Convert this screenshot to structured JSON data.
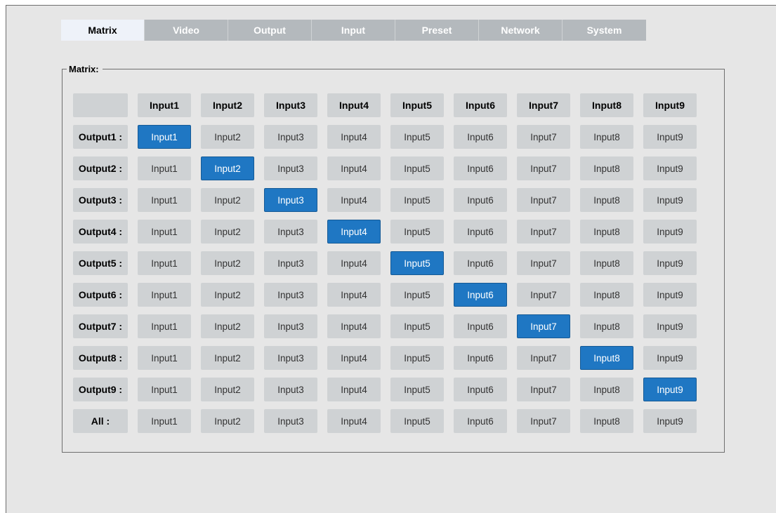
{
  "tabs": [
    {
      "label": "Matrix",
      "active": true
    },
    {
      "label": "Video",
      "active": false
    },
    {
      "label": "Output",
      "active": false
    },
    {
      "label": "Input",
      "active": false
    },
    {
      "label": "Preset",
      "active": false
    },
    {
      "label": "Network",
      "active": false
    },
    {
      "label": "System",
      "active": false
    }
  ],
  "matrix": {
    "legend": "Matrix:",
    "columns": [
      "Input1",
      "Input2",
      "Input3",
      "Input4",
      "Input5",
      "Input6",
      "Input7",
      "Input8",
      "Input9"
    ],
    "rows": [
      {
        "label": "Output1 :",
        "selected": 0
      },
      {
        "label": "Output2 :",
        "selected": 1
      },
      {
        "label": "Output3 :",
        "selected": 2
      },
      {
        "label": "Output4 :",
        "selected": 3
      },
      {
        "label": "Output5 :",
        "selected": 4
      },
      {
        "label": "Output6 :",
        "selected": 5
      },
      {
        "label": "Output7 :",
        "selected": 6
      },
      {
        "label": "Output8 :",
        "selected": 7
      },
      {
        "label": "Output9 :",
        "selected": 8
      },
      {
        "label": "All :",
        "selected": null
      }
    ],
    "button_labels": [
      "Input1",
      "Input2",
      "Input3",
      "Input4",
      "Input5",
      "Input6",
      "Input7",
      "Input8",
      "Input9"
    ]
  },
  "colors": {
    "selected": "#1f77c3",
    "button": "#cfd2d4",
    "tab_inactive": "#b4b9bd",
    "tab_active": "#eef2f9"
  }
}
